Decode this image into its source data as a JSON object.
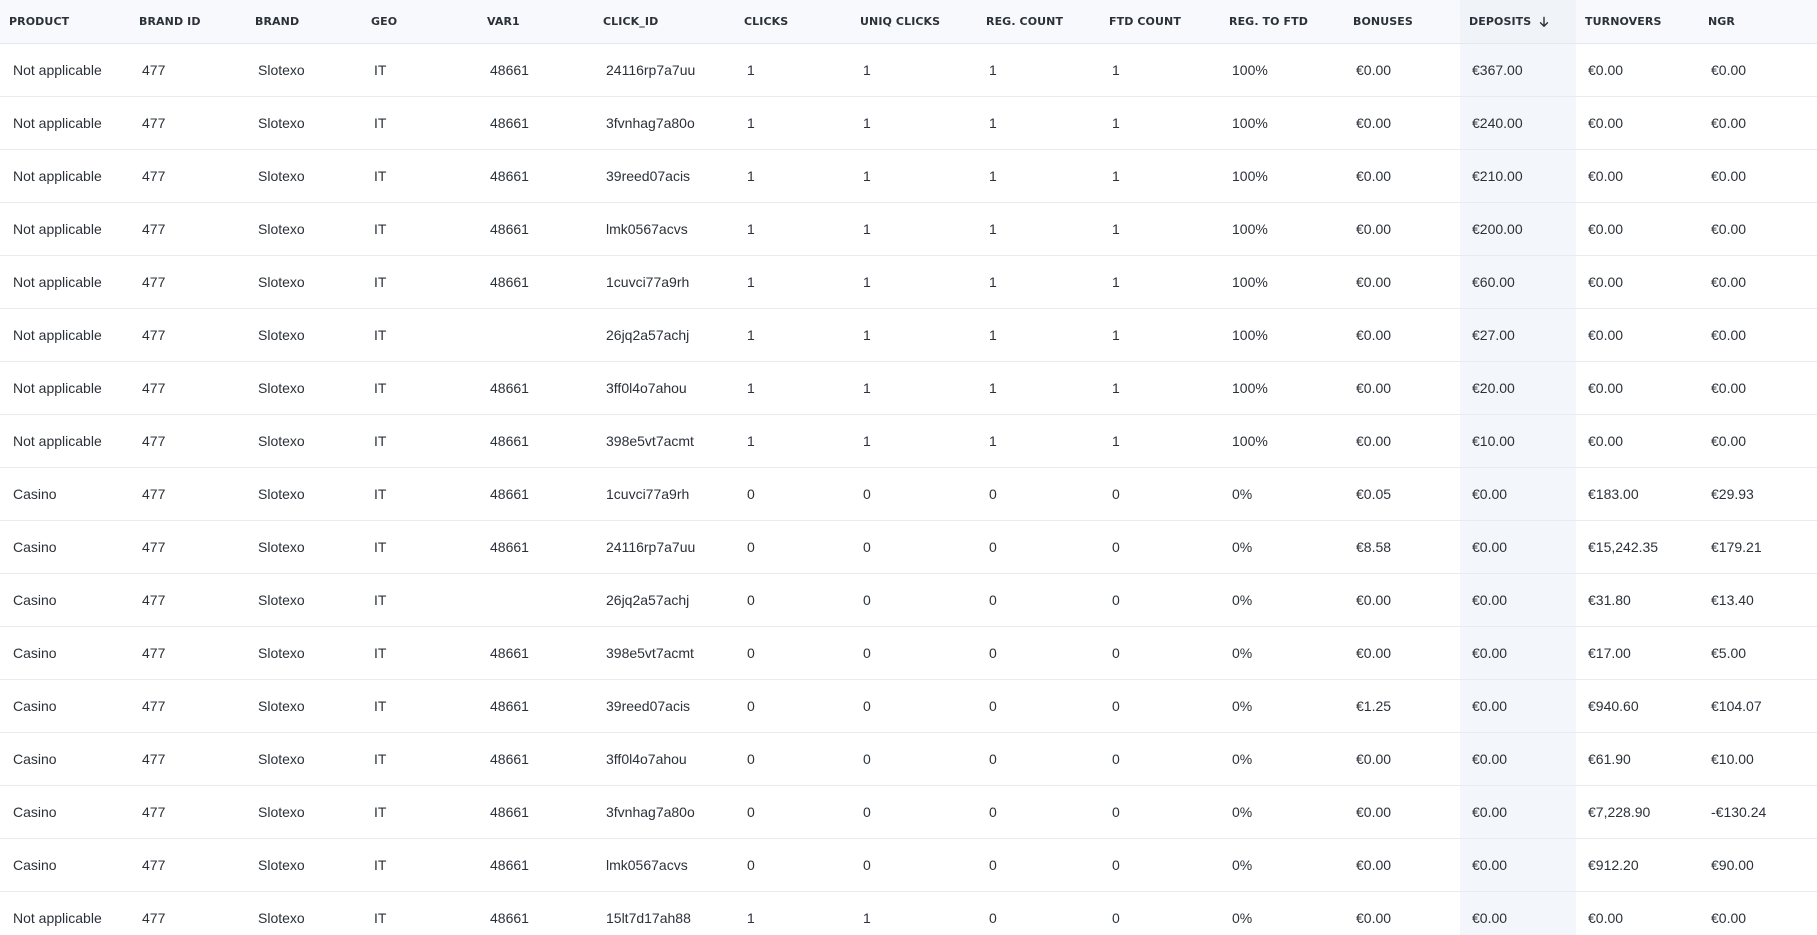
{
  "table": {
    "sort_column": "deposits",
    "sort_direction": "desc",
    "columns": [
      {
        "key": "product",
        "label": "PRODUCT"
      },
      {
        "key": "brand_id",
        "label": "BRAND ID"
      },
      {
        "key": "brand",
        "label": "BRAND"
      },
      {
        "key": "geo",
        "label": "GEO"
      },
      {
        "key": "var1",
        "label": "VAR1"
      },
      {
        "key": "click_id",
        "label": "CLICK_ID"
      },
      {
        "key": "clicks",
        "label": "CLICKS"
      },
      {
        "key": "uniq_clicks",
        "label": "UNIQ CLICKS"
      },
      {
        "key": "reg_count",
        "label": "REG. COUNT"
      },
      {
        "key": "ftd_count",
        "label": "FTD COUNT"
      },
      {
        "key": "reg_to_ftd",
        "label": "REG. TO FTD"
      },
      {
        "key": "bonuses",
        "label": "BONUSES"
      },
      {
        "key": "deposits",
        "label": "DEPOSITS"
      },
      {
        "key": "turnovers",
        "label": "TURNOVERS"
      },
      {
        "key": "ngr",
        "label": "NGR"
      }
    ],
    "rows": [
      [
        "Not applicable",
        "477",
        "Slotexo",
        "IT",
        "48661",
        "24116rp7a7uu",
        "1",
        "1",
        "1",
        "1",
        "100%",
        "€0.00",
        "€367.00",
        "€0.00",
        "€0.00"
      ],
      [
        "Not applicable",
        "477",
        "Slotexo",
        "IT",
        "48661",
        "3fvnhag7a80o",
        "1",
        "1",
        "1",
        "1",
        "100%",
        "€0.00",
        "€240.00",
        "€0.00",
        "€0.00"
      ],
      [
        "Not applicable",
        "477",
        "Slotexo",
        "IT",
        "48661",
        "39reed07acis",
        "1",
        "1",
        "1",
        "1",
        "100%",
        "€0.00",
        "€210.00",
        "€0.00",
        "€0.00"
      ],
      [
        "Not applicable",
        "477",
        "Slotexo",
        "IT",
        "48661",
        "lmk0567acvs",
        "1",
        "1",
        "1",
        "1",
        "100%",
        "€0.00",
        "€200.00",
        "€0.00",
        "€0.00"
      ],
      [
        "Not applicable",
        "477",
        "Slotexo",
        "IT",
        "48661",
        "1cuvci77a9rh",
        "1",
        "1",
        "1",
        "1",
        "100%",
        "€0.00",
        "€60.00",
        "€0.00",
        "€0.00"
      ],
      [
        "Not applicable",
        "477",
        "Slotexo",
        "IT",
        "",
        "26jq2a57achj",
        "1",
        "1",
        "1",
        "1",
        "100%",
        "€0.00",
        "€27.00",
        "€0.00",
        "€0.00"
      ],
      [
        "Not applicable",
        "477",
        "Slotexo",
        "IT",
        "48661",
        "3ff0l4o7ahou",
        "1",
        "1",
        "1",
        "1",
        "100%",
        "€0.00",
        "€20.00",
        "€0.00",
        "€0.00"
      ],
      [
        "Not applicable",
        "477",
        "Slotexo",
        "IT",
        "48661",
        "398e5vt7acmt",
        "1",
        "1",
        "1",
        "1",
        "100%",
        "€0.00",
        "€10.00",
        "€0.00",
        "€0.00"
      ],
      [
        "Casino",
        "477",
        "Slotexo",
        "IT",
        "48661",
        "1cuvci77a9rh",
        "0",
        "0",
        "0",
        "0",
        "0%",
        "€0.05",
        "€0.00",
        "€183.00",
        "€29.93"
      ],
      [
        "Casino",
        "477",
        "Slotexo",
        "IT",
        "48661",
        "24116rp7a7uu",
        "0",
        "0",
        "0",
        "0",
        "0%",
        "€8.58",
        "€0.00",
        "€15,242.35",
        "€179.21"
      ],
      [
        "Casino",
        "477",
        "Slotexo",
        "IT",
        "",
        "26jq2a57achj",
        "0",
        "0",
        "0",
        "0",
        "0%",
        "€0.00",
        "€0.00",
        "€31.80",
        "€13.40"
      ],
      [
        "Casino",
        "477",
        "Slotexo",
        "IT",
        "48661",
        "398e5vt7acmt",
        "0",
        "0",
        "0",
        "0",
        "0%",
        "€0.00",
        "€0.00",
        "€17.00",
        "€5.00"
      ],
      [
        "Casino",
        "477",
        "Slotexo",
        "IT",
        "48661",
        "39reed07acis",
        "0",
        "0",
        "0",
        "0",
        "0%",
        "€1.25",
        "€0.00",
        "€940.60",
        "€104.07"
      ],
      [
        "Casino",
        "477",
        "Slotexo",
        "IT",
        "48661",
        "3ff0l4o7ahou",
        "0",
        "0",
        "0",
        "0",
        "0%",
        "€0.00",
        "€0.00",
        "€61.90",
        "€10.00"
      ],
      [
        "Casino",
        "477",
        "Slotexo",
        "IT",
        "48661",
        "3fvnhag7a80o",
        "0",
        "0",
        "0",
        "0",
        "0%",
        "€0.00",
        "€0.00",
        "€7,228.90",
        "-€130.24"
      ],
      [
        "Casino",
        "477",
        "Slotexo",
        "IT",
        "48661",
        "lmk0567acvs",
        "0",
        "0",
        "0",
        "0",
        "0%",
        "€0.00",
        "€0.00",
        "€912.20",
        "€90.00"
      ],
      [
        "Not applicable",
        "477",
        "Slotexo",
        "IT",
        "48661",
        "15lt7d17ah88",
        "1",
        "1",
        "0",
        "0",
        "0%",
        "€0.00",
        "€0.00",
        "€0.00",
        "€0.00"
      ]
    ]
  }
}
